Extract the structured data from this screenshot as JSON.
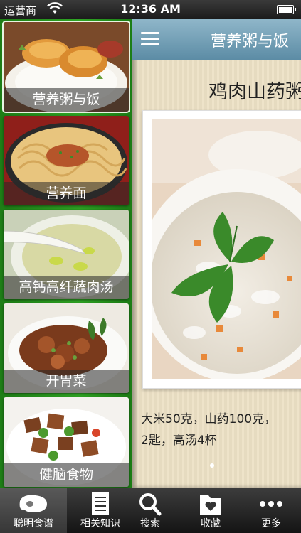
{
  "status_bar": {
    "carrier": "运营商",
    "time": "12:36 AM"
  },
  "sidebar": {
    "items": [
      {
        "label": "营养粥与饭",
        "icon": "rice-with-pork-cutlet-photo"
      },
      {
        "label": "营养面",
        "icon": "noodles-photo"
      },
      {
        "label": "高钙高纤蔬肉汤",
        "icon": "soup-photo"
      },
      {
        "label": "开胃菜",
        "icon": "appetizer-photo"
      },
      {
        "label": "健脑食物",
        "icon": "brain-food-photo"
      }
    ]
  },
  "header": {
    "title": "营养粥与饭"
  },
  "recipe": {
    "title": "鸡肉山药粥",
    "ingredients": "大米50克，山药100克，\n2匙，高汤4杯",
    "photo_icon": "chicken-yam-porridge-photo"
  },
  "tabbar": {
    "tabs": [
      {
        "label": "聪明食谱",
        "icon": "steak-icon"
      },
      {
        "label": "相关知识",
        "icon": "document-icon"
      },
      {
        "label": "搜索",
        "icon": "search-icon"
      },
      {
        "label": "收藏",
        "icon": "favorite-folder-icon"
      },
      {
        "label": "更多",
        "icon": "more-dots-icon"
      }
    ],
    "selected_index": 0
  },
  "colors": {
    "sidebar_green": "#2fa524",
    "navbar_blue": "#6f9db5",
    "content_bg": "#ede2c6",
    "tabbar_dark": "#1e1e1e"
  }
}
